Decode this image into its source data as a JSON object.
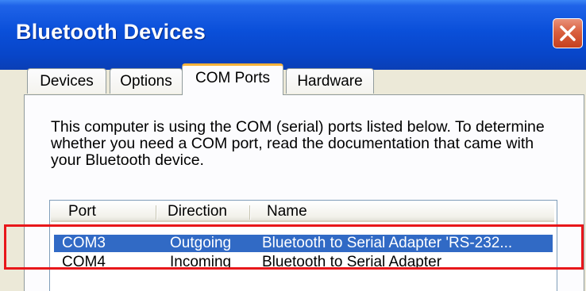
{
  "window": {
    "title": "Bluetooth Devices",
    "close_icon": "close-icon"
  },
  "tabs": [
    {
      "label": "Devices",
      "active": false
    },
    {
      "label": "Options",
      "active": false
    },
    {
      "label": "COM Ports",
      "active": true
    },
    {
      "label": "Hardware",
      "active": false
    }
  ],
  "com_ports": {
    "description": "This computer is using the COM (serial) ports listed below. To determine whether you need a COM port, read the documentation that came with your Bluetooth device.",
    "columns": [
      "Port",
      "Direction",
      "Name"
    ],
    "rows": [
      {
        "port": "COM3",
        "direction": "Outgoing",
        "name": "Bluetooth to Serial Adapter 'RS-232...",
        "selected": true
      },
      {
        "port": "COM4",
        "direction": "Incoming",
        "name": "Bluetooth to Serial Adapter",
        "selected": false
      }
    ]
  },
  "colors": {
    "titlebar": "#0a4fd9",
    "selection": "#316ac5",
    "highlight": "#e8171a",
    "active_tab_accent": "#f8b33c"
  }
}
